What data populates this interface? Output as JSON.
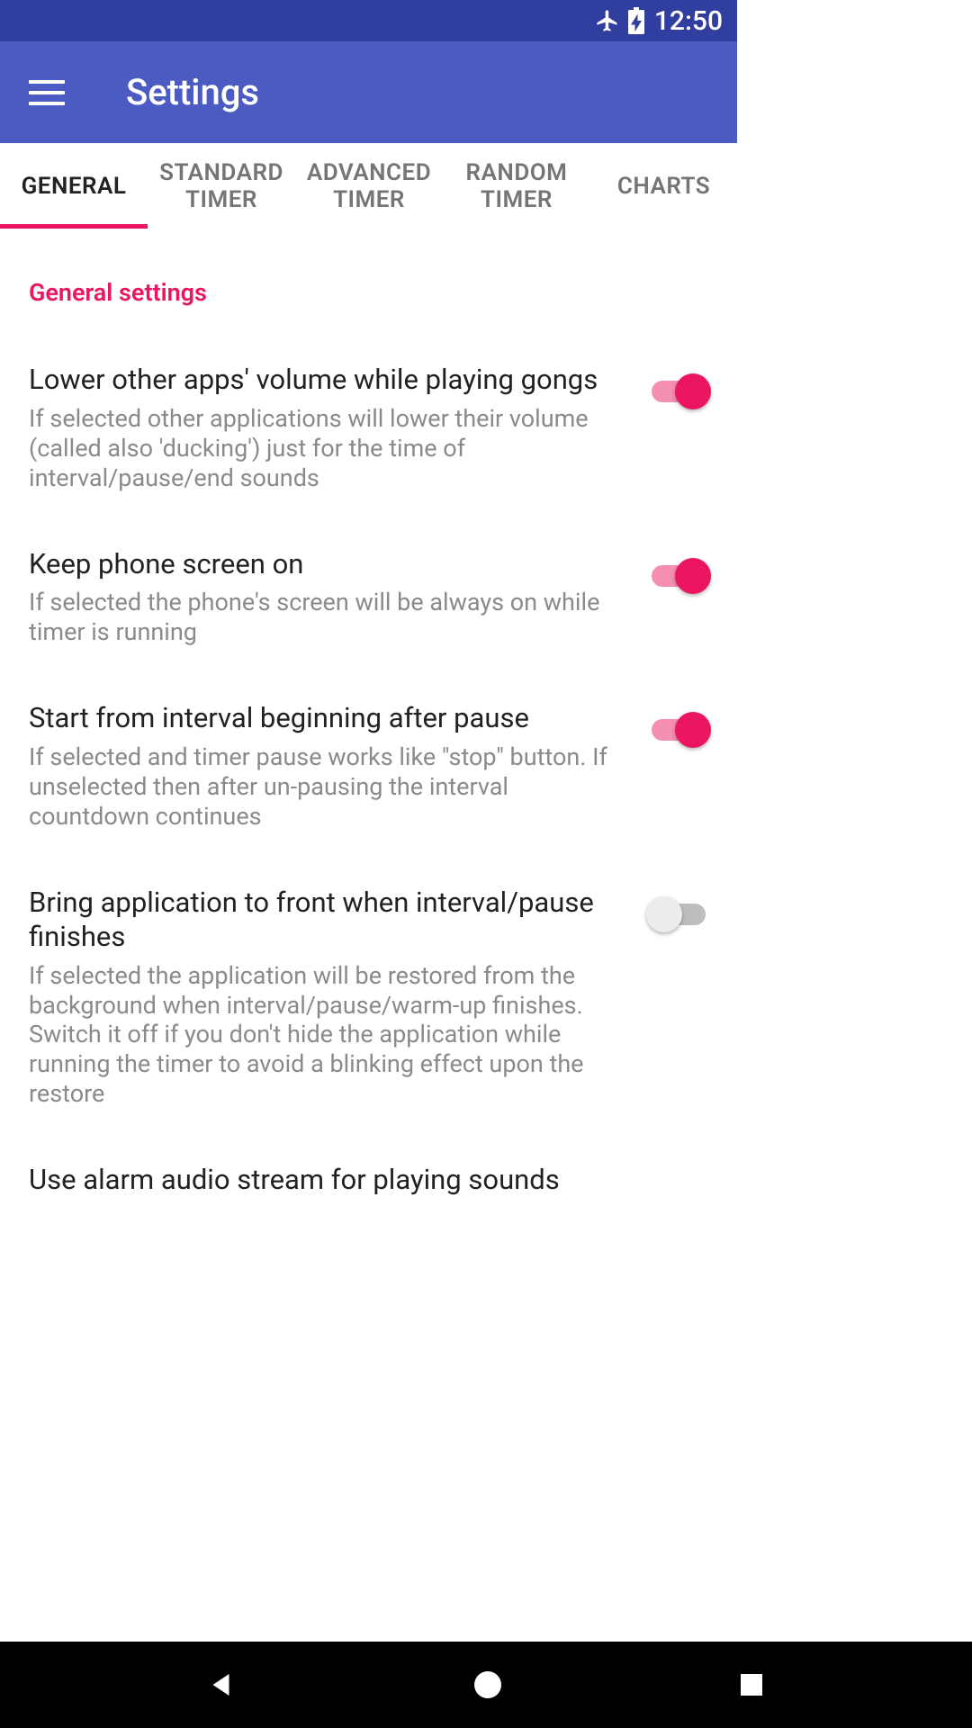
{
  "statusBar": {
    "time": "12:50",
    "airplane": true,
    "batteryCharging": true
  },
  "appBar": {
    "title": "Settings"
  },
  "tabs": [
    {
      "label": "GENERAL",
      "active": true
    },
    {
      "label": "STANDARD TIMER",
      "active": false
    },
    {
      "label": "ADVANCED TIMER",
      "active": false
    },
    {
      "label": "RANDOM TIMER",
      "active": false
    },
    {
      "label": "CHARTS",
      "active": false
    }
  ],
  "sectionHeader": "General settings",
  "settings": [
    {
      "title": "Lower other apps' volume while playing gongs",
      "desc": "If selected other applications will lower their volume (called also 'ducking') just for the time of interval/pause/end sounds",
      "on": true
    },
    {
      "title": "Keep phone screen on",
      "desc": "If selected the phone's screen will be always on while timer is running",
      "on": true
    },
    {
      "title": "Start from interval beginning after pause",
      "desc": "If selected and timer pause works like \"stop\" button. If unselected then after un-pausing the interval countdown continues",
      "on": true
    },
    {
      "title": "Bring application to front when interval/pause finishes",
      "desc": "If selected the application will be restored from the background when interval/pause/warm-up finishes. Switch it off if you don't hide the application while running the timer to avoid a blinking effect upon the restore",
      "on": false
    },
    {
      "title": "Use alarm audio stream for playing sounds",
      "desc": "",
      "on": false
    }
  ]
}
